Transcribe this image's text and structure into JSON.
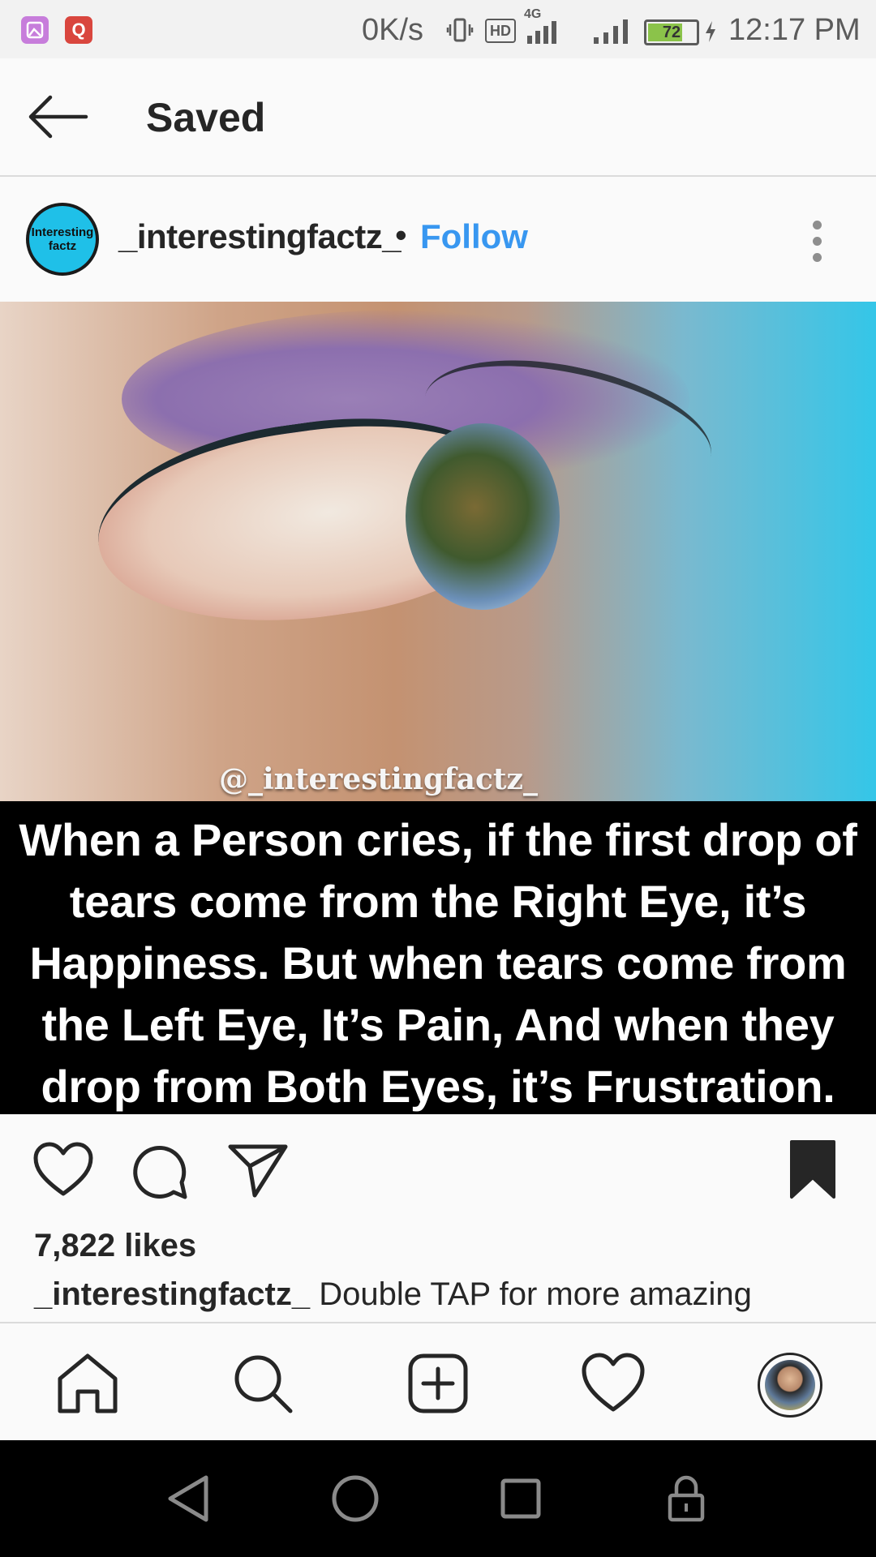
{
  "status_bar": {
    "speed": "0K/s",
    "hd": "HD",
    "network": "4G",
    "battery": "72",
    "battery_level": 0.72,
    "time": "12:17 PM",
    "app_icons": [
      "gallery-app-icon",
      "q-app-icon"
    ]
  },
  "header": {
    "title": "Saved",
    "back_icon": "arrow-left-icon"
  },
  "post": {
    "avatar_text_line1": "Interesting",
    "avatar_text_line2": "factz",
    "username": "_interestingfactz_",
    "separator": "•",
    "follow_label": "Follow",
    "image_watermark": "@_interestingfactz_",
    "quote": "When a Person cries, if the first drop of tears come from the Right Eye, it’s Happiness. But when tears come from the Left Eye, It’s Pain, And when they drop from Both Eyes, it’s Frustration.",
    "likes": "7,822 likes",
    "caption_user": "_interestingfactz_",
    "caption_text": "Double TAP for more amazing"
  },
  "bottom_nav": [
    "home-icon",
    "search-icon",
    "new-post-icon",
    "activity-heart-icon",
    "profile-avatar"
  ],
  "android_nav": [
    "back-triangle-icon",
    "home-circle-icon",
    "recents-square-icon",
    "lock-icon"
  ],
  "colors": {
    "follow_blue": "#3897f0",
    "text_dark": "#262626",
    "battery_green": "#8bc34a"
  }
}
